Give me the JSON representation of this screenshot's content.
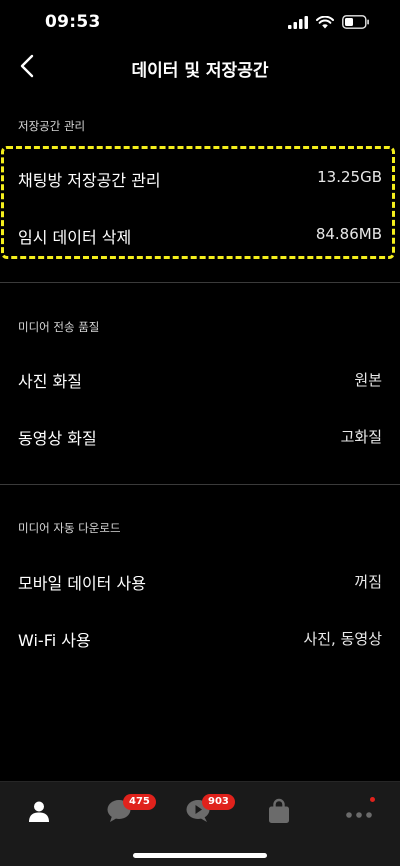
{
  "status_bar": {
    "time": "09:53"
  },
  "nav": {
    "title": "데이터 및 저장공간",
    "back_icon": "chevron-left-icon"
  },
  "sections": [
    {
      "header": "저장공간 관리",
      "rows": [
        {
          "label": "채팅방 저장공간 관리",
          "value": "13.25GB"
        },
        {
          "label": "임시 데이터 삭제",
          "value": "84.86MB"
        }
      ]
    },
    {
      "header": "미디어 전송 품질",
      "rows": [
        {
          "label": "사진 화질",
          "value": "원본"
        },
        {
          "label": "동영상 화질",
          "value": "고화질"
        }
      ]
    },
    {
      "header": "미디어 자동 다운로드",
      "rows": [
        {
          "label": "모바일 데이터 사용",
          "value": "꺼짐"
        },
        {
          "label": "Wi-Fi 사용",
          "value": "사진, 동영상"
        }
      ]
    }
  ],
  "tabbar": {
    "tabs": [
      {
        "icon": "person-icon"
      },
      {
        "icon": "chat-bubble-icon",
        "badge": "475"
      },
      {
        "icon": "play-bubble-icon",
        "badge": "903"
      },
      {
        "icon": "shopping-bag-icon"
      },
      {
        "icon": "more-dots-icon"
      }
    ]
  },
  "colors": {
    "background": "#000000",
    "highlight": "#f4ee1c",
    "badge": "#e0221c",
    "tabbar": "#1a1a1a"
  }
}
